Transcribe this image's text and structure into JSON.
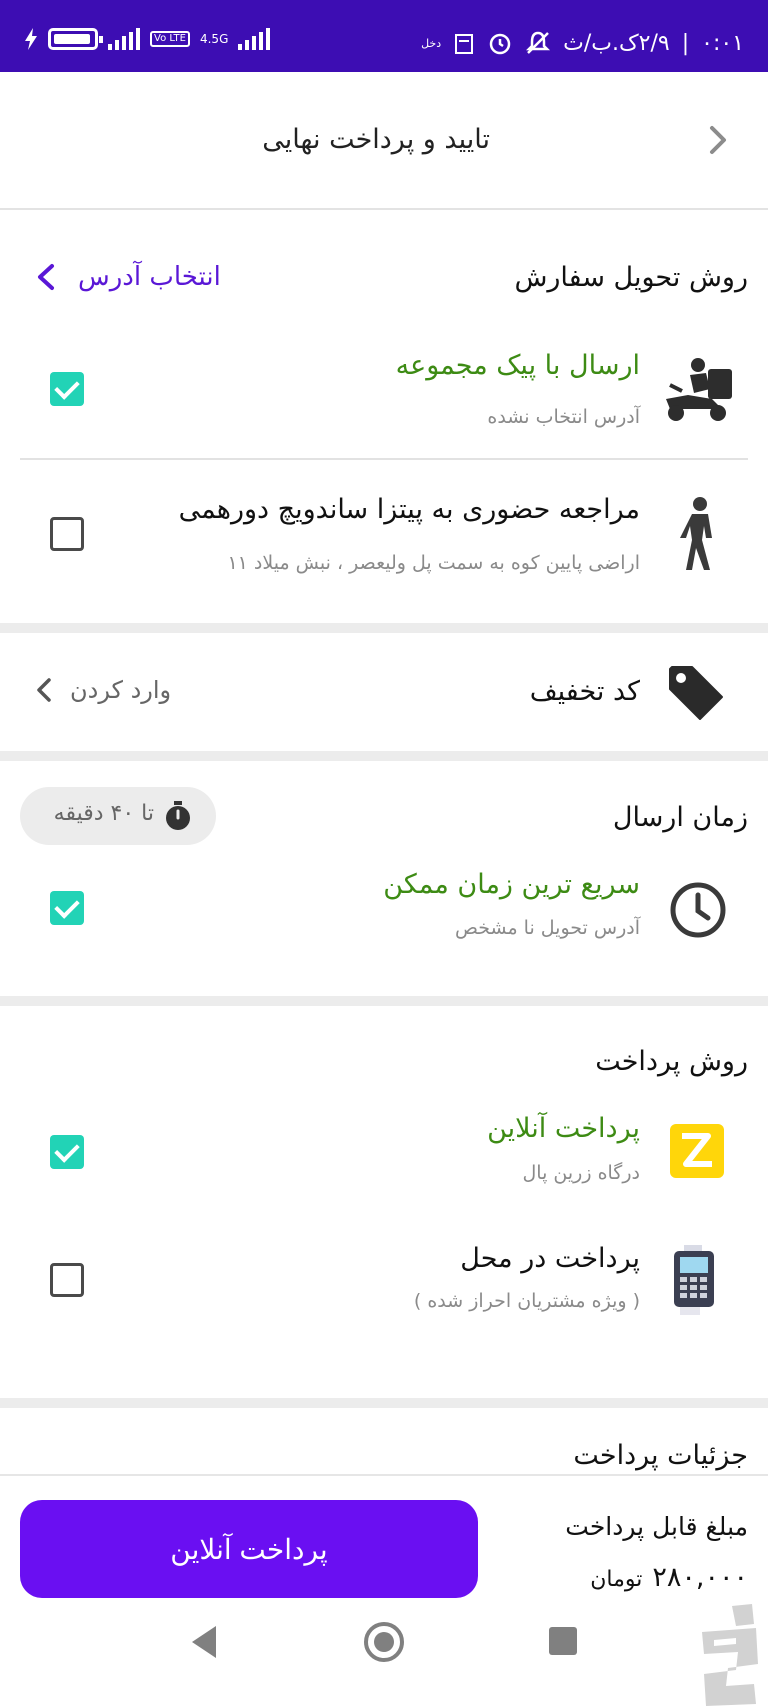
{
  "status_bar": {
    "time": "۰:۰۱",
    "date": "۲/۹ک.ب/ث",
    "network_type": "4.5G",
    "volte": "Vo LTE",
    "carrier_small": "دخل"
  },
  "header": {
    "title": "تایید و پرداخت نهایی"
  },
  "delivery": {
    "heading": "روش تحویل سفارش",
    "select_address": "انتخاب آدرس",
    "options": [
      {
        "title": "ارسال با پیک مجموعه",
        "subtitle": "آدرس انتخاب نشده",
        "checked": true,
        "icon": "delivery-scooter-icon"
      },
      {
        "title": "مراجعه حضوری به پیتزا ساندویچ دورهمی",
        "subtitle": "اراضی پایین کوه به سمت پل ولیعصر ، نبش میلاد ۱۱",
        "checked": false,
        "icon": "walking-person-icon"
      }
    ]
  },
  "discount": {
    "label": "کد تخفیف",
    "action": "وارد کردن"
  },
  "send_time": {
    "heading": "زمان ارسال",
    "chip": "تا ۴۰ دقیقه",
    "option": {
      "title": "سریع ترین زمان ممکن",
      "subtitle": "آدرس تحویل نا مشخص",
      "checked": true
    }
  },
  "payment_method": {
    "heading": "روش پرداخت",
    "options": [
      {
        "title": "پرداخت آنلاین",
        "subtitle": "درگاه زرین پال",
        "checked": true,
        "icon": "zarinpal-icon"
      },
      {
        "title": "پرداخت در محل",
        "subtitle": "( ویژه مشتریان احراز شده )",
        "checked": false,
        "icon": "card-reader-icon"
      }
    ]
  },
  "payment_details": {
    "heading": "جزئیات پرداخت"
  },
  "checkout": {
    "amount_label": "مبلغ قابل پرداخت",
    "amount": "۲۸۰,۰۰۰",
    "currency": "تومان",
    "button": "پرداخت آنلاین"
  },
  "colors": {
    "status_bar": "#3d0db3",
    "primary": "#6a0ff2",
    "accent_text": "#5a17d6",
    "green_text": "#3d8b14",
    "checkbox": "#22d3b6"
  }
}
